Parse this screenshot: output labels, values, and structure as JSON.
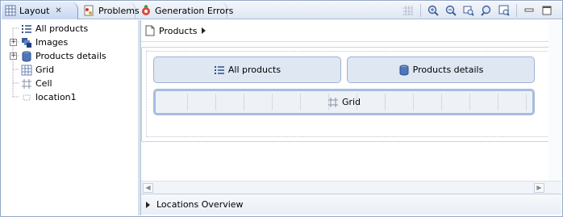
{
  "tabs": [
    {
      "label": "Layout",
      "icon": "layout-grid-icon",
      "active": true
    },
    {
      "label": "Problems",
      "icon": "problems-icon",
      "active": false
    },
    {
      "label": "Generation Errors",
      "icon": "generation-errors-icon",
      "active": false
    }
  ],
  "toolbar": {
    "buttons": [
      "grid-toggle-icon",
      "zoom-in-icon",
      "zoom-out-icon",
      "zoom-fit-icon",
      "zoom-selection-icon",
      "zoom-page-icon",
      "minimize-icon",
      "maximize-icon"
    ]
  },
  "tree": {
    "items": [
      {
        "label": "All products",
        "icon": "list-icon",
        "expandable": false
      },
      {
        "label": "Images",
        "icon": "images-icon",
        "expandable": true
      },
      {
        "label": "Products details",
        "icon": "database-icon",
        "expandable": true
      },
      {
        "label": "Grid",
        "icon": "grid-icon",
        "expandable": false
      },
      {
        "label": "Cell",
        "icon": "cell-icon",
        "expandable": false
      },
      {
        "label": "location1",
        "icon": "location-icon",
        "expandable": false
      }
    ]
  },
  "editor": {
    "breadcrumb": "Products",
    "cells": [
      "All products",
      "Products details",
      "Grid"
    ],
    "overview_label": "Locations Overview"
  },
  "colors": {
    "accent": "#a6bde0",
    "cell_fill": "#dfe7f3",
    "tab_active": "#c7d7ef"
  }
}
